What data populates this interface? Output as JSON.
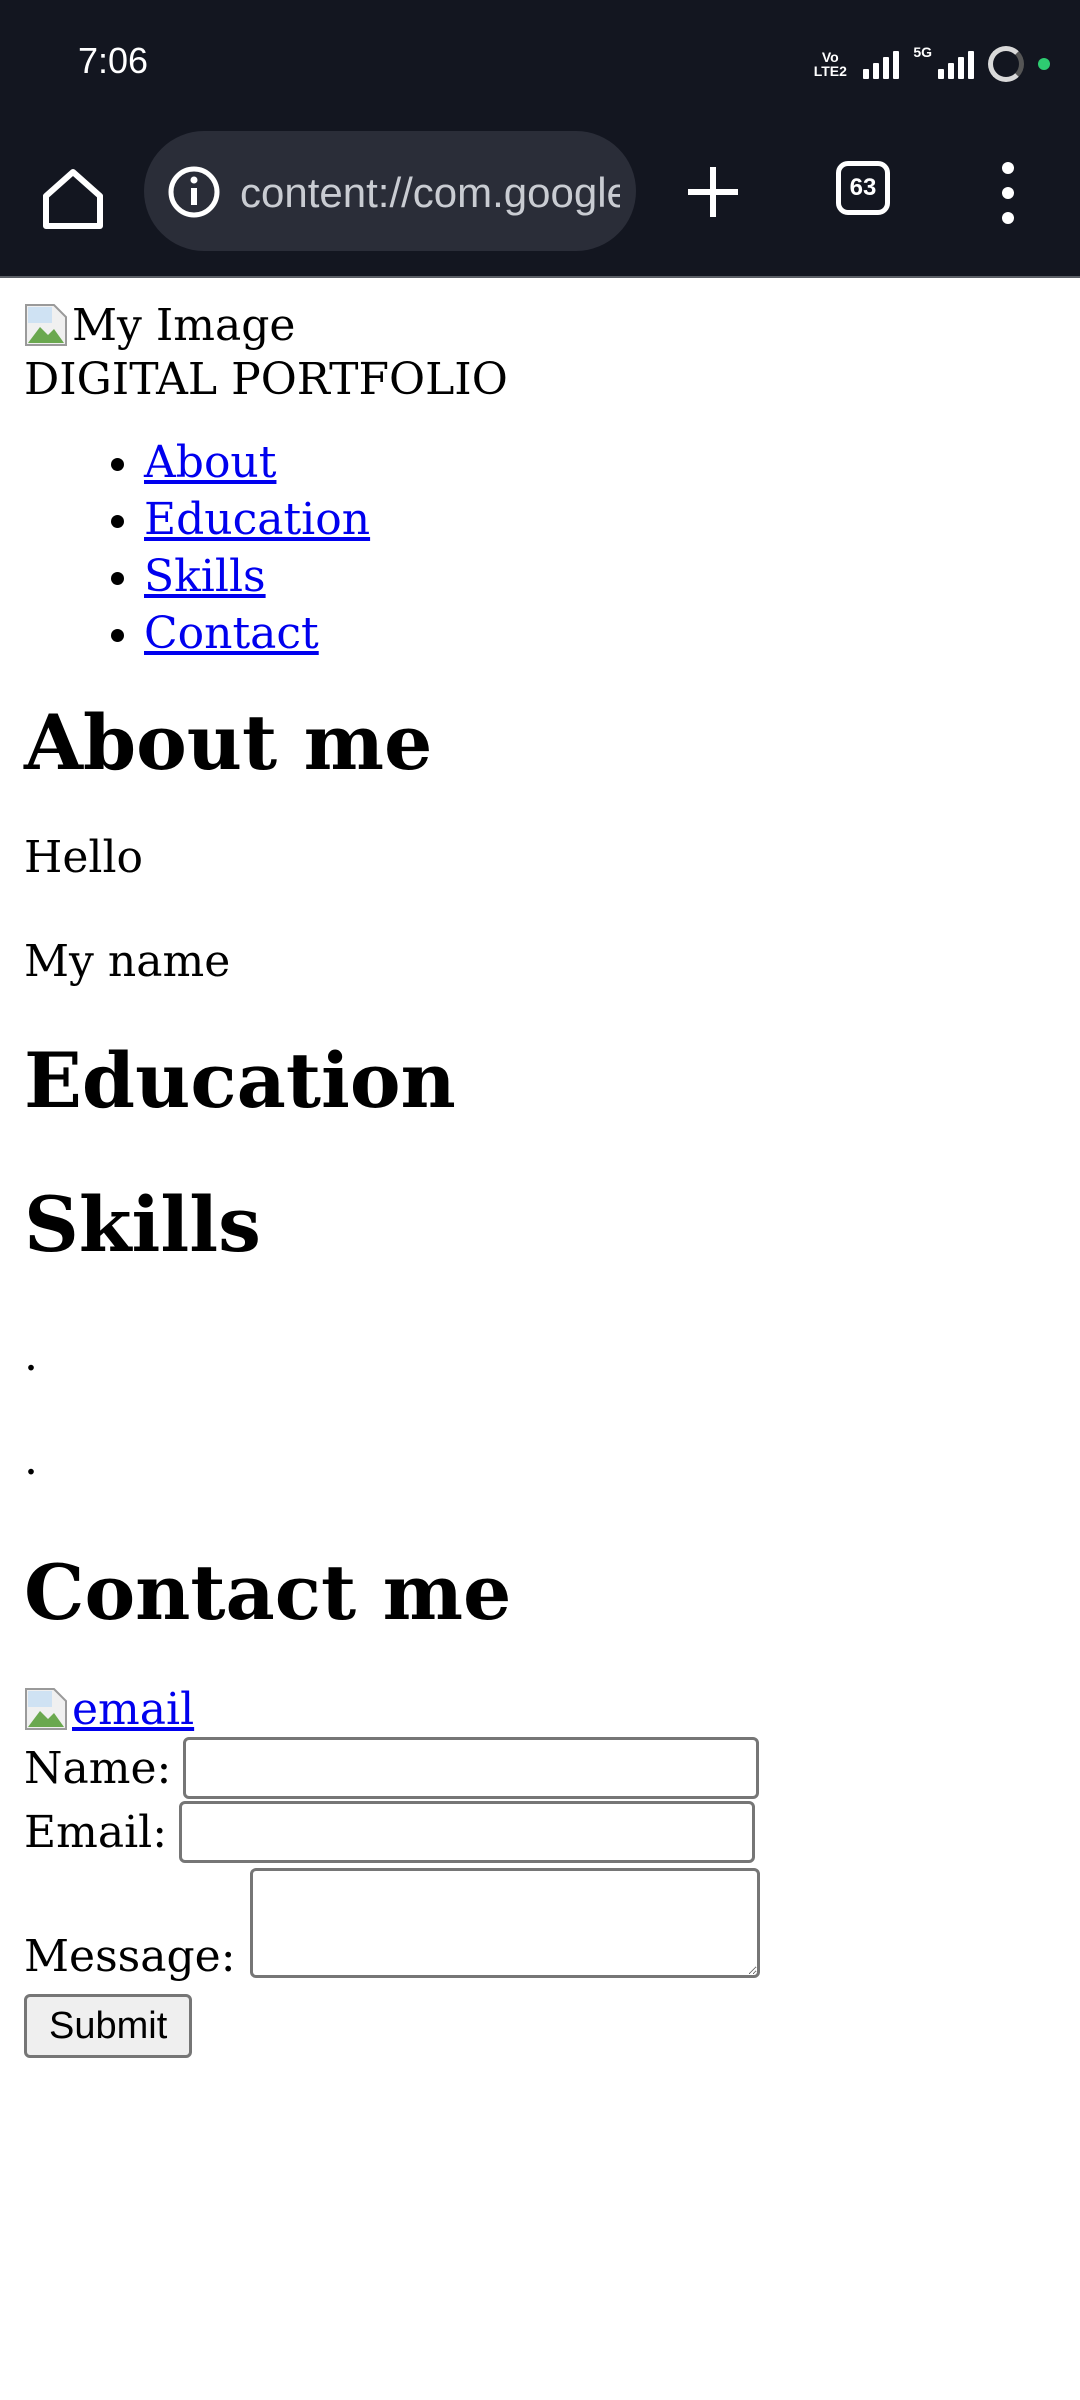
{
  "status_bar": {
    "time": "7:06",
    "volte_label": "Vo LTE2",
    "network_label": "5G",
    "icons": [
      "volte-icon",
      "signal-icon",
      "signal-5g-icon",
      "sync-ring-icon",
      "privacy-dot-icon"
    ]
  },
  "browser": {
    "url": "content://com.google.android.apps.nbu.files.provider",
    "tab_count": "63",
    "icons": [
      "home-icon",
      "site-info-icon",
      "new-tab-icon",
      "tab-switcher-icon",
      "overflow-menu-icon"
    ]
  },
  "page": {
    "header_image_alt": "My Image",
    "site_title": "DIGITAL PORTFOLIO",
    "nav": [
      "About",
      "Education",
      "Skills",
      "Contact"
    ],
    "about_heading": "About me",
    "about_p1": "Hello",
    "about_p2": "My name",
    "education_heading": "Education",
    "skills_heading": "Skills",
    "skills_p1": ".",
    "skills_p2": ".",
    "contact_heading": "Contact me",
    "email_link_alt": "email",
    "form": {
      "name_label": "Name:",
      "name_value": "",
      "email_label": "Email:",
      "email_value": "",
      "message_label": "Message:",
      "message_value": "",
      "submit_label": "Submit"
    }
  },
  "colors": {
    "chrome_bg": "#131620",
    "url_bar_bg": "#2a2d38",
    "link": "#0000ee",
    "status_dot": "#2ecc71"
  }
}
